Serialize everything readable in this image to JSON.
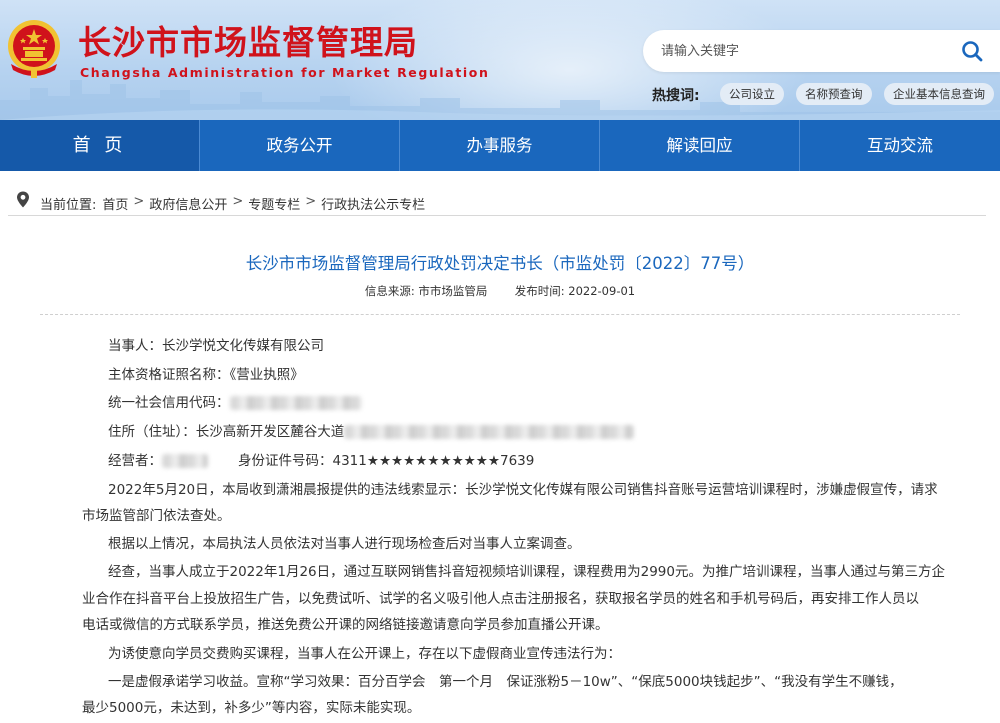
{
  "header": {
    "title": "长沙市市场监督管理局",
    "subtitle": "Changsha Administration for Market Regulation",
    "search_placeholder": "请输入关键字",
    "hot_label": "热搜词:",
    "hot_tags": [
      "公司设立",
      "名称预查询",
      "企业基本信息查询"
    ]
  },
  "nav": {
    "items": [
      "首 页",
      "政务公开",
      "办事服务",
      "解读回应",
      "互动交流"
    ]
  },
  "breadcrumb": {
    "label": "当前位置:",
    "items": [
      "首页",
      "政府信息公开",
      "专题专栏",
      "行政执法公示专栏"
    ],
    "separator": ">"
  },
  "article": {
    "title": "长沙市市场监督管理局行政处罚决定书长（市监处罚〔2022〕77号）",
    "source_label": "信息来源:",
    "source": "市市场监管局",
    "date_label": "发布时间:",
    "date": "2022-09-01",
    "party": "当事人：长沙学悦文化传媒有限公司",
    "license_name": "主体资格证照名称：《营业执照》",
    "credit_code_label": "统一社会信用代码：",
    "address_prefix": "住所（住址）：长沙高新开发区麓谷大道",
    "operator_label": "经营者：",
    "id_label": "身份证件号码：",
    "id_value": "4311★★★★★★★★★★★7639",
    "para1_line1": "2022年5月20日，本局收到潇湘晨报提供的违法线索显示：长沙学悦文化传媒有限公司销售抖音账号运营培训课程时，涉嫌虚假宣传，请求",
    "para1_line2": "市场监管部门依法查处。",
    "para2": "根据以上情况，本局执法人员依法对当事人进行现场检查后对当事人立案调查。",
    "para3_line1": "经查，当事人成立于2022年1月26日，通过互联网销售抖音短视频培训课程，课程费用为2990元。为推广培训课程，当事人通过与第三方企",
    "para3_line2": "业合作在抖音平台上投放招生广告，以免费试听、试学的名义吸引他人点击注册报名，获取报名学员的姓名和手机号码后，再安排工作人员以",
    "para3_line3": "电话或微信的方式联系学员，推送免费公开课的网络链接邀请意向学员参加直播公开课。",
    "para4": "为诱使意向学员交费购买课程，当事人在公开课上，存在以下虚假商业宣传违法行为：",
    "para5_line1": "一是虚假承诺学习收益。宣称“学习效果：百分百学会　第一个月　保证涨粉5－10w”、“保底5000块钱起步”、“我没有学生不赚钱，",
    "para5_line2": "最少5000元，未达到，补多少”等内容，实际未能实现。"
  },
  "colors": {
    "brand_red": "#d0121b",
    "nav_blue": "#1a67bd",
    "title_blue": "#1a67bd"
  }
}
